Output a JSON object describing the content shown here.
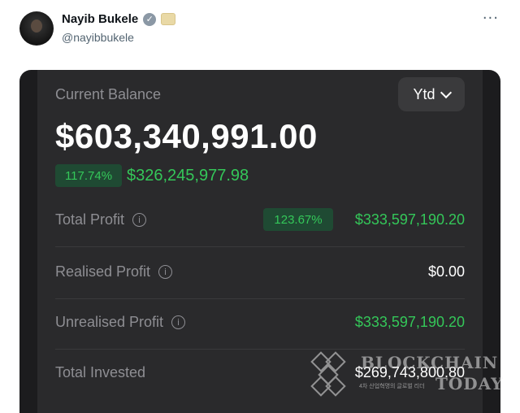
{
  "tweet": {
    "name": "Nayib Bukele",
    "handle": "@nayibbukele",
    "more_icon": "more-horizontal-icon",
    "verified_icon": "verified-badge-icon"
  },
  "card": {
    "current_balance_label": "Current Balance",
    "period_selector": "Ytd",
    "balance": "$603,340,991.00",
    "change_pct": "117.74%",
    "change_amount": "$326,245,977.98",
    "rows": [
      {
        "label": "Total Profit",
        "pct": "123.67%",
        "value": "$333,597,190.20"
      },
      {
        "label": "Realised Profit",
        "value": "$0.00"
      },
      {
        "label": "Unrealised Profit",
        "value": "$333,597,190.20"
      },
      {
        "label": "Total Invested",
        "value": "$269,743,800.80"
      }
    ]
  },
  "watermark": {
    "line1": "BLOCKCHAIN",
    "line2": "TODAY",
    "small": "4차 산업혁명의 글로벌 리더"
  },
  "colors": {
    "card_bg": "#2a2a2c",
    "positive": "#34c759",
    "badge_bg": "#1f4a33"
  }
}
